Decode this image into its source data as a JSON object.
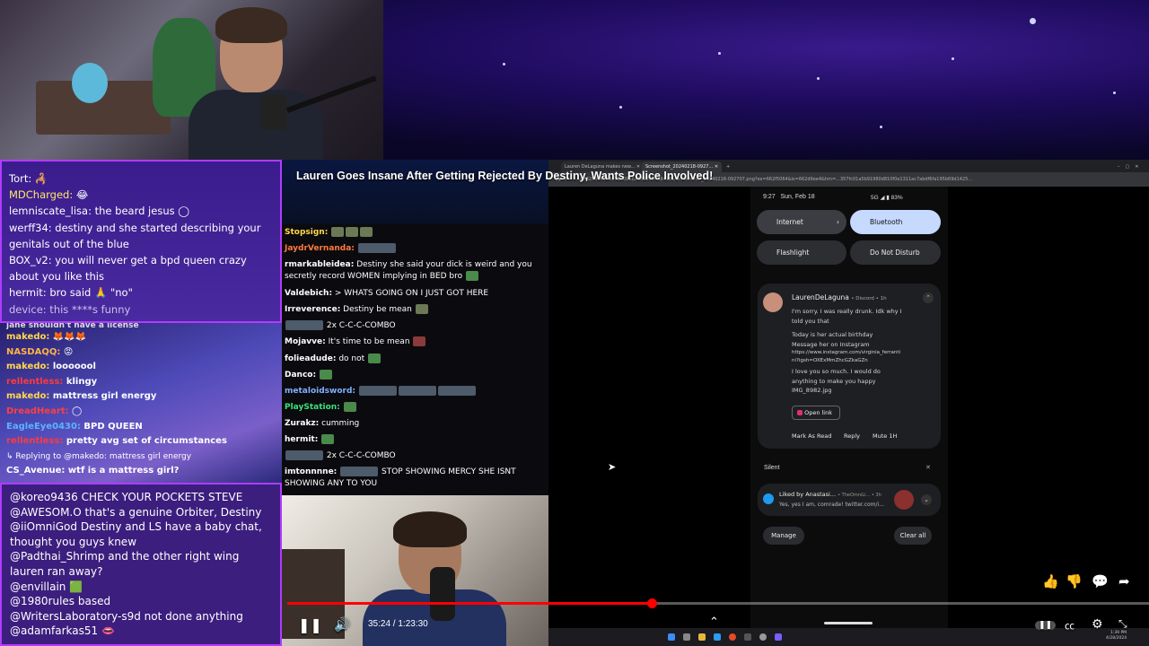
{
  "video": {
    "title": "Lauren Goes Insane After Getting Rejected By Destiny, Wants Police Involved!",
    "time_current": "35:24",
    "time_total": "1:23:30",
    "time_separator": " / ",
    "progress_percent": 42.3
  },
  "chat_top": [
    {
      "user": "Tort:",
      "text": " 🦂"
    },
    {
      "user": "MDCharged:",
      "text": " 😂"
    },
    {
      "user": "lemniscate_lisa:",
      "text": " the beard jesus ◯"
    },
    {
      "user": "werff34:",
      "text": " destiny and she started describing your genitals out of the blue"
    },
    {
      "user": "BOX_v2:",
      "text": " you will never get a bpd queen crazy about you like this"
    },
    {
      "user": "hermit:",
      "text": " bro said 🙏 \"no\""
    },
    {
      "user": "device:",
      "text": " this ****s funny"
    }
  ],
  "chat_mid_left": [
    {
      "user": "makedo:",
      "text": " 🦊🦊🦊",
      "color": "#ffd84d"
    },
    {
      "user": "NASDAQQ:",
      "text": " 😡",
      "color": "#ffb347"
    },
    {
      "user": "makedo:",
      "text": " looooool",
      "color": "#ffd84d"
    },
    {
      "user": "rellentless:",
      "text": " klingy",
      "color": "#ff3b3b"
    },
    {
      "user": "makedo:",
      "text": " mattress girl energy",
      "color": "#ffd84d"
    },
    {
      "user": "DreadHeart:",
      "text": " ◯",
      "color": "#ff4040"
    },
    {
      "user": "EagleEye0430:",
      "text": " BPD QUEEN",
      "color": "#5ab4ff"
    },
    {
      "user": "rellentless:",
      "text": " pretty avg set of circumstances",
      "color": "#ff3b3b"
    },
    {
      "user": "↳ Replying to @makedo:",
      "text": " mattress girl energy",
      "color": "#e0e0e0"
    },
    {
      "user": "CS_Avenue:",
      "text": " wtf is a mattress girl?",
      "color": "#ffffff"
    }
  ],
  "chat_mid_left_partial": "jane shouldn't have a license",
  "chat_bottom": [
    {
      "user": "@koreo9436",
      "text": " CHECK YOUR POCKETS STEVE"
    },
    {
      "user": "@AWESOM.O",
      "text": " that's a genuine Orbiter, Destiny"
    },
    {
      "user": "@iiOmniGod",
      "text": " Destiny and LS have a baby chat, thought you guys knew"
    },
    {
      "user": "@Padthai_Shrimp",
      "text": " and the other right wing lauren ran away?"
    },
    {
      "user": "@envillain",
      "text": " 🟩"
    },
    {
      "user": "@1980rules",
      "text": " based"
    },
    {
      "user": "@WritersLaboratory-s9d",
      "text": " not done anything"
    },
    {
      "user": "@adamfarkas51",
      "text": " 👄"
    }
  ],
  "chat_center": [
    {
      "user": "Stopsign:",
      "text": "",
      "color": "#ffd84d"
    },
    {
      "user": "JaydrVernanda:",
      "text": "",
      "color": "#ff7a3d"
    },
    {
      "user": "rmarkableidea:",
      "text": " Destiny she said your dick is weird and you secretly record WOMEN implying in BED bro",
      "color": "#ffffff"
    },
    {
      "user": "Valdebich:",
      "text": " > WHATS GOING ON I JUST GOT HERE",
      "color": "#ffffff"
    },
    {
      "user": "Irreverence:",
      "text": " Destiny be mean",
      "color": "#ffffff"
    },
    {
      "user": "",
      "text": " 2x C-C-C-COMBO",
      "color": "#ffffff"
    },
    {
      "user": "Mojavve:",
      "text": " It's time to be mean",
      "color": "#ffffff"
    },
    {
      "user": "folieadude:",
      "text": " do not",
      "color": "#ffffff"
    },
    {
      "user": "Danco:",
      "text": "",
      "color": "#ffffff"
    },
    {
      "user": "metaloidsword:",
      "text": "",
      "color": "#7fb0ff"
    },
    {
      "user": "PlayStation:",
      "text": "",
      "color": "#3be07a"
    },
    {
      "user": "Zurakz:",
      "text": " cumming",
      "color": "#ffffff"
    },
    {
      "user": "hermit:",
      "text": "",
      "color": "#ffffff"
    },
    {
      "user": "",
      "text": " 2x C-C-C-COMBO",
      "color": "#ffffff"
    },
    {
      "user": "imtonnnne:",
      "text": " STOP SHOWING MERCY SHE ISNT SHOWING ANY TO YOU",
      "color": "#ffffff"
    }
  ],
  "browser": {
    "tab1": "Lauren DeLaguna makes new...",
    "tab2": "Screenshot_20240218-0927...",
    "address": "...e73256543442912088621850954384181/Screenshot_20240218-092707.png?ex=662f5064&is=662d9ee4&hm=...357fc01a5b91980d810f0e1311ac7abdf6fa195b69d1425..."
  },
  "phone": {
    "time": "9:27",
    "date": "Sun, Feb 18",
    "status": "5G ◢ ▮ 83%",
    "tiles": [
      "Internet",
      "Bluetooth",
      "Flashlight",
      "Do Not Disturb"
    ],
    "notification": {
      "sender": "LaurenDeLaguna",
      "app": "• Discord • 1h",
      "lines": [
        "I'm sorry. I was really drunk. Idk why I told you that",
        "Today is her actual birthday",
        "Message her on Instagram",
        "https://www.instagram.com/virginia_ferrantini?igsh=OXExMmZhcGZkaGZn",
        "I love you so much. I would do anything to make you happy",
        "IMG_8982.jpg"
      ],
      "open_link": "Open link",
      "actions": [
        "Mark As Read",
        "Reply",
        "Mute 1H"
      ]
    },
    "silent_label": "Silent",
    "notif2_title": "Liked by Anastasi...",
    "notif2_app": "• TheOmniLi... • 3h",
    "notif2_text": "Yes, yes I am, comrade! twitter.com/i...",
    "manage": "Manage",
    "clear_all": "Clear all"
  },
  "clock": {
    "time": "1:39 PM",
    "date": "4/28/2024"
  },
  "icons": [
    "pause-icon",
    "volume-icon",
    "chevron-up-icon",
    "like-icon",
    "dislike-icon",
    "comment-icon",
    "share-icon",
    "captions-icon",
    "settings-icon",
    "fullscreen-exit-icon"
  ],
  "colors": {
    "accent_red": "#ff0000",
    "chat_border": "#b13bff",
    "tile_active": "#c6d9ff"
  }
}
